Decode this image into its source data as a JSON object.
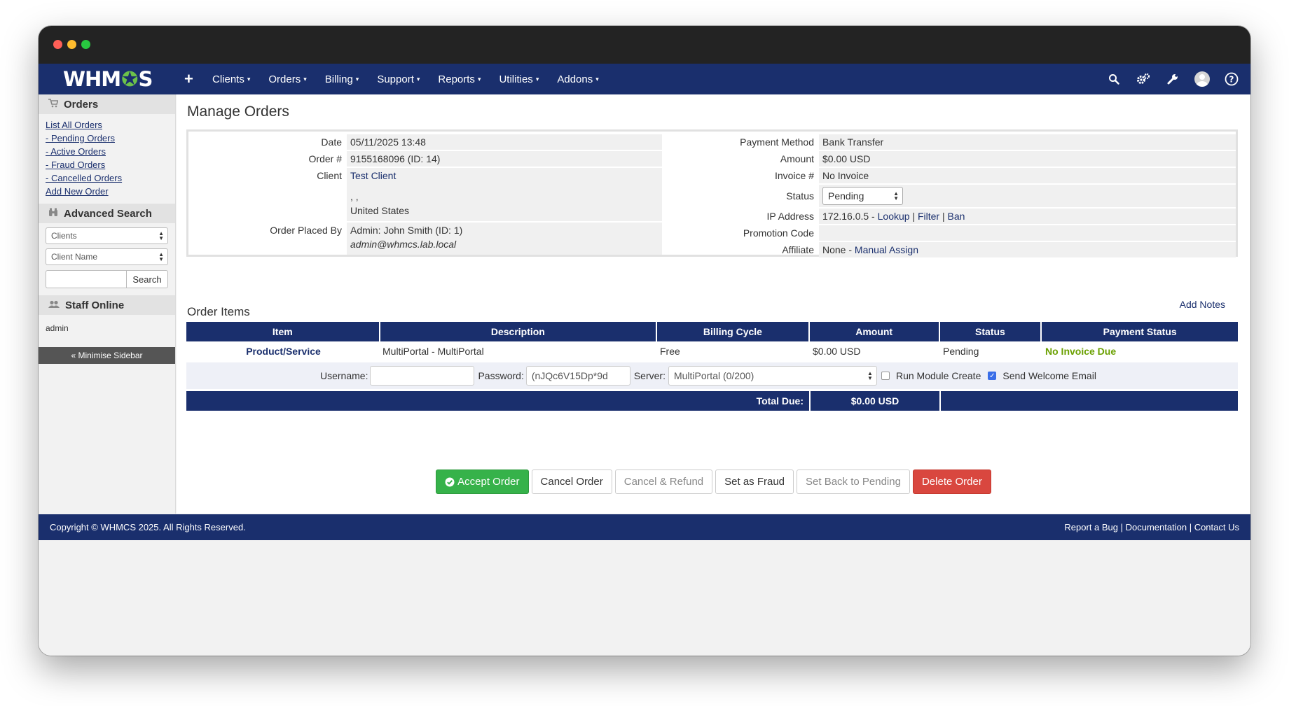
{
  "nav": {
    "logo_prefix": "WHM",
    "logo_gear": "✪",
    "logo_suffix": "S",
    "plus": "+",
    "items": [
      {
        "label": "Clients"
      },
      {
        "label": "Orders"
      },
      {
        "label": "Billing"
      },
      {
        "label": "Support"
      },
      {
        "label": "Reports"
      },
      {
        "label": "Utilities"
      },
      {
        "label": "Addons"
      }
    ],
    "caret": "▾"
  },
  "sidebar": {
    "orders_title": "Orders",
    "links": [
      {
        "label": "List All Orders"
      },
      {
        "label": "- Pending Orders"
      },
      {
        "label": "- Active Orders"
      },
      {
        "label": "- Fraud Orders"
      },
      {
        "label": "- Cancelled Orders"
      },
      {
        "label": "Add New Order"
      }
    ],
    "advanced_search_title": "Advanced Search",
    "search_type": "Clients",
    "search_field": "Client Name",
    "search_button": "Search",
    "staff_title": "Staff Online",
    "staff_name": "admin",
    "minimise": "« Minimise Sidebar"
  },
  "main": {
    "title": "Manage Orders",
    "order": {
      "date_label": "Date",
      "date": "05/11/2025 13:48",
      "order_num_label": "Order #",
      "order_num": "9155168096 (ID: 14)",
      "client_label": "Client",
      "client_name": "Test Client",
      "client_addr1": ", ,",
      "client_country": "United States",
      "placed_by_label": "Order Placed By",
      "placed_by": "Admin: John Smith (ID: 1)",
      "placed_by_email": "admin@whmcs.lab.local",
      "payment_method_label": "Payment Method",
      "payment_method": "Bank Transfer",
      "amount_label": "Amount",
      "amount": "$0.00 USD",
      "invoice_label": "Invoice #",
      "invoice": "No Invoice",
      "status_label": "Status",
      "status": "Pending",
      "ip_label": "IP Address",
      "ip": "172.16.0.5 - ",
      "ip_lookup": "Lookup",
      "ip_filter": "Filter",
      "ip_ban": "Ban",
      "sep": " | ",
      "promo_label": "Promotion Code",
      "promo": "",
      "affiliate_label": "Affiliate",
      "affiliate": "None - ",
      "affiliate_link": "Manual Assign"
    },
    "order_items_title": "Order Items",
    "add_notes": "Add Notes",
    "items_table": {
      "headers": [
        "Item",
        "Description",
        "Billing Cycle",
        "Amount",
        "Status",
        "Payment Status"
      ],
      "row": {
        "item": "Product/Service",
        "description": "MultiPortal - MultiPortal",
        "billing_cycle": "Free",
        "amount": "$0.00 USD",
        "status": "Pending",
        "payment_status": "No Invoice Due"
      },
      "username_label": "Username:",
      "username_value": "",
      "password_label": "Password:",
      "password_value": "(nJQc6V15Dp*9d",
      "server_label": "Server:",
      "server_value": "MultiPortal (0/200)",
      "run_module_label": "Run Module Create",
      "send_welcome_label": "Send Welcome Email",
      "total_label": "Total Due:",
      "total_value": "$0.00 USD"
    },
    "actions": {
      "accept": "Accept Order",
      "cancel": "Cancel Order",
      "cancel_refund": "Cancel & Refund",
      "fraud": "Set as Fraud",
      "back_pending": "Set Back to Pending",
      "delete": "Delete Order"
    }
  },
  "footer": {
    "copyright": "Copyright © WHMCS 2025. All Rights Reserved.",
    "report_bug": "Report a Bug",
    "documentation": "Documentation",
    "contact": "Contact Us",
    "sep": " | "
  },
  "colors": {
    "navbar": "#1a2f6d",
    "success": "#36b24a",
    "danger": "#d9473f",
    "no_invoice_due": "#6aa000"
  }
}
